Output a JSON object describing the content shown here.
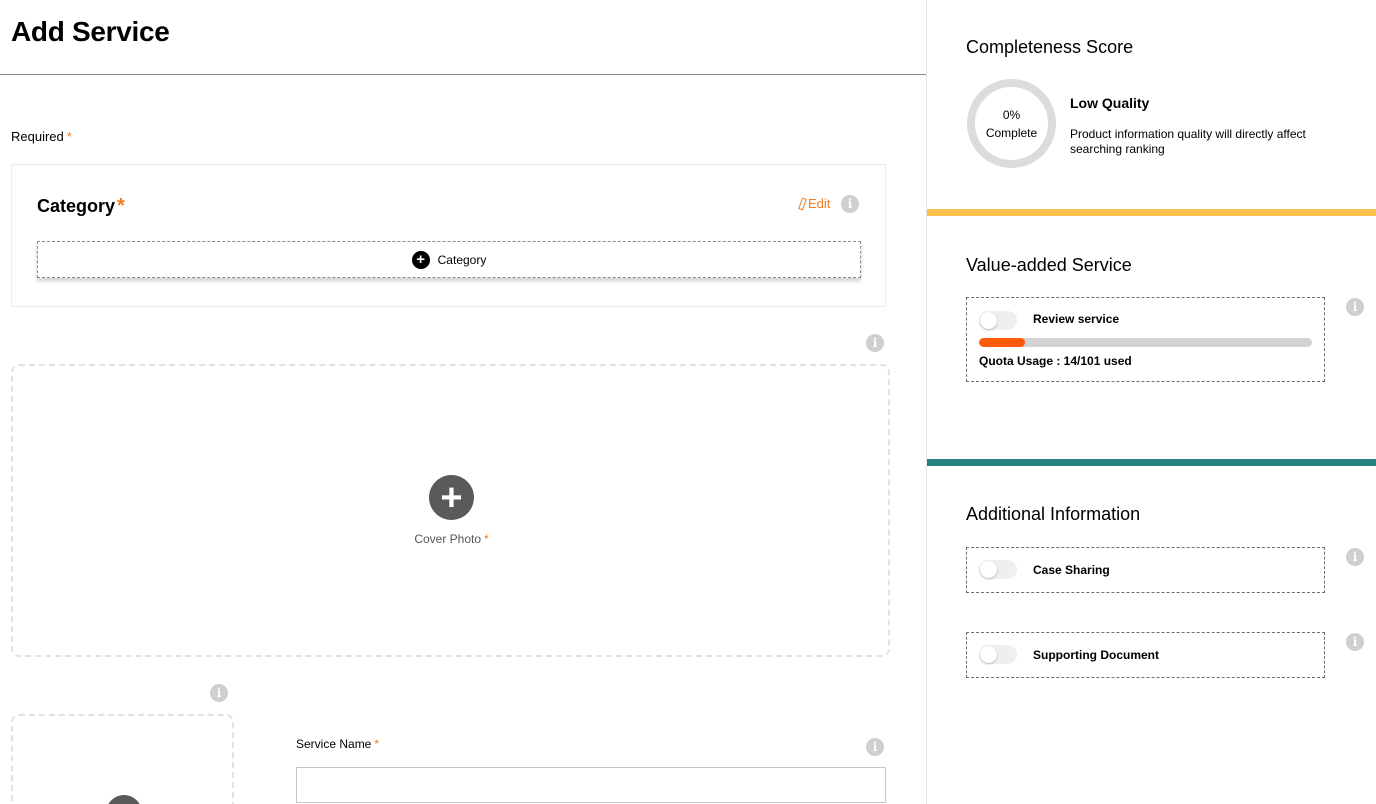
{
  "page": {
    "title": "Add Service"
  },
  "form": {
    "required_label": "Required",
    "required_star": "*",
    "category": {
      "title": "Category",
      "star": "*",
      "edit_label": "Edit",
      "button_label": "Category",
      "button_icon": "plus-circle-icon"
    },
    "cover_photo": {
      "label": "Cover Photo",
      "star": "*",
      "icon": "plus-circle-icon"
    },
    "thumbnail": {
      "icon": "plus-circle-icon"
    },
    "service_name": {
      "label": "Service Name",
      "star": "*",
      "value": "",
      "placeholder": ""
    },
    "info_icon": "info-icon",
    "info_glyph": "i"
  },
  "sidebar": {
    "completeness": {
      "heading": "Completeness Score",
      "percent": "0%",
      "percent_value": 0,
      "complete_label": "Complete",
      "quality_title": "Low Quality",
      "quality_desc": "Product information quality will directly affect searching ranking"
    },
    "value_added": {
      "heading": "Value-added Service",
      "review_label": "Review service",
      "review_enabled": false,
      "quota_text": "Quota Usage : 14/101 used",
      "quota_used": 14,
      "quota_total": 101
    },
    "additional": {
      "heading": "Additional Information",
      "case_sharing_label": "Case Sharing",
      "case_sharing_enabled": false,
      "supporting_doc_label": "Supporting Document",
      "supporting_doc_enabled": false
    }
  },
  "colors": {
    "accent_orange": "#f07b1d",
    "quota_fill": "#ff5a0a",
    "stripe_yellow": "#f9c04e",
    "stripe_teal": "#28827f",
    "icon_gray": "#5a5a5a"
  }
}
